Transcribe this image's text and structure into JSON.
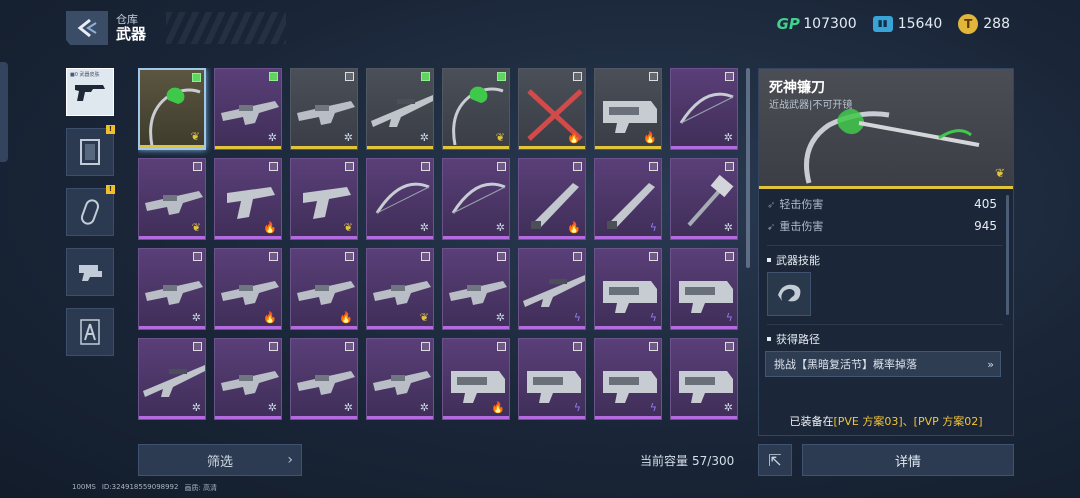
{
  "header": {
    "subtitle": "仓库",
    "title": "武器"
  },
  "currencies": [
    {
      "icon": "gp-currency-icon",
      "symbol": "GP",
      "value": "107300"
    },
    {
      "icon": "ticket-currency-icon",
      "symbol": "",
      "value": "15640"
    },
    {
      "icon": "gold-coin-icon",
      "symbol": "",
      "value": "288"
    }
  ],
  "categories": [
    {
      "name": "category-weapons",
      "icon": "pistol-icon",
      "active": true,
      "badge": false,
      "tag": "■0 武器皮肤"
    },
    {
      "name": "category-frames",
      "icon": "frame-icon",
      "active": false,
      "badge": true,
      "tag": ""
    },
    {
      "name": "category-accessories",
      "icon": "capsule-icon",
      "active": false,
      "badge": true,
      "tag": ""
    },
    {
      "name": "category-parts",
      "icon": "part-icon",
      "active": false,
      "badge": false,
      "tag": ""
    },
    {
      "name": "category-compass",
      "icon": "compass-icon",
      "active": false,
      "badge": false,
      "tag": ""
    }
  ],
  "badge_symbol": "!",
  "weapon_grid": [
    {
      "rarity": "gold",
      "bar": "yellow",
      "checked": true,
      "element": "nature",
      "weapon": "scythe",
      "selected": true
    },
    {
      "rarity": "purple",
      "bar": "yellow",
      "checked": true,
      "element": "ice",
      "weapon": "rifle"
    },
    {
      "rarity": "gray",
      "bar": "yellow",
      "checked": false,
      "element": "ice",
      "weapon": "rifle"
    },
    {
      "rarity": "gray",
      "bar": "yellow",
      "checked": true,
      "element": "ice",
      "weapon": "sniper"
    },
    {
      "rarity": "gray",
      "bar": "yellow",
      "checked": true,
      "element": "nature",
      "weapon": "scythe"
    },
    {
      "rarity": "gray",
      "bar": "yellow",
      "checked": false,
      "element": "fire",
      "weapon": "cross"
    },
    {
      "rarity": "gray",
      "bar": "yellow",
      "checked": false,
      "element": "fire",
      "weapon": "heavy"
    },
    {
      "rarity": "purple",
      "bar": "purple",
      "checked": false,
      "element": "ice",
      "weapon": "bow"
    },
    {
      "rarity": "purple",
      "bar": "purple",
      "checked": false,
      "element": "nature",
      "weapon": "rifle"
    },
    {
      "rarity": "purple",
      "bar": "purple",
      "checked": false,
      "element": "fire",
      "weapon": "pistol"
    },
    {
      "rarity": "purple",
      "bar": "purple",
      "checked": false,
      "element": "nature",
      "weapon": "pistol"
    },
    {
      "rarity": "purple",
      "bar": "purple",
      "checked": false,
      "element": "ice",
      "weapon": "bow"
    },
    {
      "rarity": "purple",
      "bar": "purple",
      "checked": false,
      "element": "ice",
      "weapon": "bow"
    },
    {
      "rarity": "purple",
      "bar": "purple",
      "checked": false,
      "element": "fire",
      "weapon": "knife"
    },
    {
      "rarity": "purple",
      "bar": "purple",
      "checked": false,
      "element": "lightning",
      "weapon": "knife"
    },
    {
      "rarity": "purple",
      "bar": "purple",
      "checked": false,
      "element": "ice",
      "weapon": "hammer"
    },
    {
      "rarity": "purple",
      "bar": "purple",
      "checked": false,
      "element": "ice",
      "weapon": "rifle"
    },
    {
      "rarity": "purple",
      "bar": "purple",
      "checked": false,
      "element": "fire",
      "weapon": "rifle"
    },
    {
      "rarity": "purple",
      "bar": "purple",
      "checked": false,
      "element": "fire",
      "weapon": "rifle"
    },
    {
      "rarity": "purple",
      "bar": "purple",
      "checked": false,
      "element": "nature",
      "weapon": "rifle"
    },
    {
      "rarity": "purple",
      "bar": "purple",
      "checked": false,
      "element": "ice",
      "weapon": "rifle"
    },
    {
      "rarity": "purple",
      "bar": "purple",
      "checked": false,
      "element": "lightning",
      "weapon": "sniper"
    },
    {
      "rarity": "purple",
      "bar": "purple",
      "checked": false,
      "element": "lightning",
      "weapon": "heavy"
    },
    {
      "rarity": "purple",
      "bar": "purple",
      "checked": false,
      "element": "lightning",
      "weapon": "heavy"
    },
    {
      "rarity": "purple",
      "bar": "purple",
      "checked": false,
      "element": "ice",
      "weapon": "sniper"
    },
    {
      "rarity": "purple",
      "bar": "purple",
      "checked": false,
      "element": "ice",
      "weapon": "rifle"
    },
    {
      "rarity": "purple",
      "bar": "purple",
      "checked": false,
      "element": "ice",
      "weapon": "rifle"
    },
    {
      "rarity": "purple",
      "bar": "purple",
      "checked": false,
      "element": "ice",
      "weapon": "rifle"
    },
    {
      "rarity": "purple",
      "bar": "purple",
      "checked": false,
      "element": "fire",
      "weapon": "heavy"
    },
    {
      "rarity": "purple",
      "bar": "purple",
      "checked": false,
      "element": "lightning",
      "weapon": "heavy"
    },
    {
      "rarity": "purple",
      "bar": "purple",
      "checked": false,
      "element": "lightning",
      "weapon": "heavy"
    },
    {
      "rarity": "purple",
      "bar": "purple",
      "checked": false,
      "element": "ice",
      "weapon": "heavy"
    }
  ],
  "element_glyphs": {
    "nature": "❦",
    "ice": "✲",
    "fire": "🔥",
    "lightning": "ϟ"
  },
  "element_colors": {
    "nature": "#e2c43b",
    "ice": "#c9d6e6",
    "fire": "#f0a02a",
    "lightning": "#8e7cf0"
  },
  "toolbar": {
    "filter_label": "筛选",
    "filter_chevron": "›",
    "capacity_label": "当前容量",
    "capacity_value": "57/300",
    "details_label": "详情",
    "share_glyph": "⇱"
  },
  "detail": {
    "name": "死神镰刀",
    "type": "近战武器|不可开镜",
    "light_label": "轻击伤害",
    "light_value": "405",
    "heavy_label": "重击伤害",
    "heavy_value": "945",
    "skill_title": "武器技能",
    "source_title": "获得路径",
    "source_text": "挑战【黑暗复活节】概率掉落",
    "source_chevron": "»",
    "equipped_prefix": "已装备在",
    "equipped_plans": "[PVE 方案03]、[PVP 方案02]",
    "element_glyph": "❦"
  },
  "footer": {
    "ping": "100MS",
    "id": "ID:324918559098992",
    "quality": "画质: 高清"
  },
  "colors": {
    "accent_gold": "#e2c43b",
    "rarity_purple": "#b46be0",
    "gp_green": "#3fd28a"
  }
}
